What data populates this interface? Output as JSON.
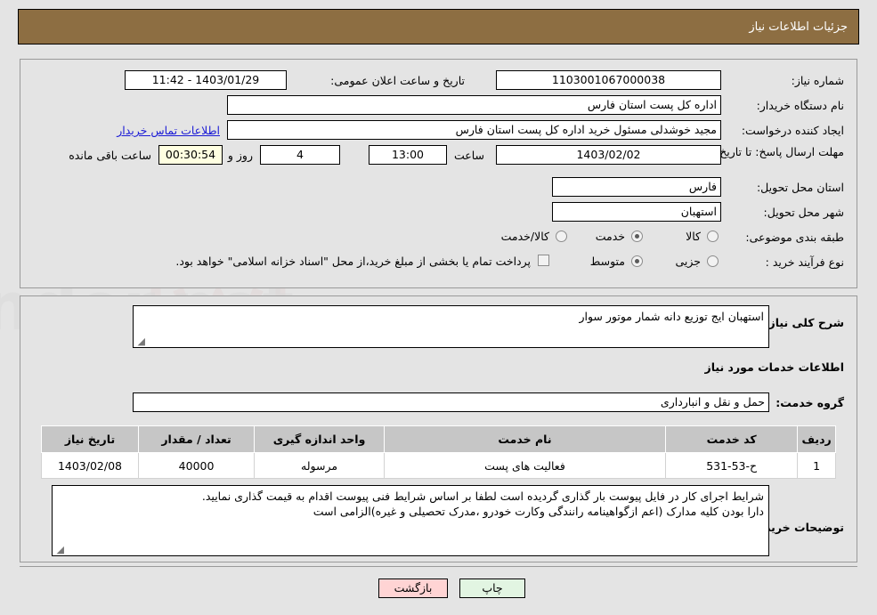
{
  "header": {
    "title": "جزئیات اطلاعات نیاز",
    "bar_color": "#8d6e42"
  },
  "form": {
    "need_number": {
      "label": "شماره نیاز:",
      "value": "1103001067000038"
    },
    "public_announce": {
      "label": "تاریخ و ساعت اعلان عمومی:",
      "value": "1403/01/29 - 11:42"
    },
    "buyer_org": {
      "label": "نام دستگاه خریدار:",
      "value": "اداره کل پست استان فارس"
    },
    "request_creator": {
      "label": "ایجاد کننده درخواست:",
      "value": "مجید خوشدلی مسئول خرید اداره کل پست استان فارس"
    },
    "contact_link": "اطلاعات تماس خریدار",
    "response_deadline": {
      "label": "مهلت ارسال پاسخ: تا تاریخ:",
      "date": "1403/02/02",
      "hour_label": "ساعت",
      "hour": "13:00",
      "days": "4",
      "days_label": "روز و",
      "countdown": "00:30:54",
      "remaining_label": "ساعت باقی مانده"
    },
    "delivery_province": {
      "label": "استان محل تحویل:",
      "value": "فارس"
    },
    "delivery_city": {
      "label": "شهر محل تحویل:",
      "value": "استهبان"
    },
    "subject_category": {
      "label": "طبقه بندی موضوعی:",
      "options": [
        "کالا",
        "خدمت",
        "کالا/خدمت"
      ],
      "selected": "خدمت"
    },
    "purchase_process": {
      "label": "نوع فرآیند خرید :",
      "options": [
        "جزیی",
        "متوسط"
      ],
      "selected": "متوسط"
    },
    "treasury_checkbox": {
      "checked": false,
      "label": "پرداخت تمام یا بخشی از مبلغ خرید،از محل \"اسناد خزانه اسلامی\" خواهد بود."
    }
  },
  "need_description": {
    "label": "شرح کلی نیاز:",
    "value": "استهبان ایج توزیع دانه شمار موتور سوار"
  },
  "services_section": {
    "heading": "اطلاعات خدمات مورد نیاز",
    "service_group": {
      "label": "گروه خدمت:",
      "value": "حمل و نقل و انبارداری"
    }
  },
  "services_table": {
    "columns": [
      "ردیف",
      "کد خدمت",
      "نام خدمت",
      "واحد اندازه گیری",
      "تعداد / مقدار",
      "تاریخ نیاز"
    ],
    "rows": [
      {
        "row_no": "1",
        "service_code": "ح-53-531",
        "service_name": "فعالیت های پست",
        "unit": "مرسوله",
        "quantity": "40000",
        "need_date": "1403/02/08"
      }
    ]
  },
  "buyer_notes": {
    "label": "توضیحات خریدار:",
    "line1": "شرایط اجرای کار در فایل پیوست بار گذاری گردیده است لطفا بر اساس شرایط فنی پیوست اقدام به قیمت گذاری نمایید.",
    "line2": "دارا بودن کلیه مدارک (اعم ازگواهینامه رانندگی وکارت خودرو ،مدرک تحصیلی و غیره)الزامی است"
  },
  "footer": {
    "back_button": "بازگشت",
    "print_button": "چاپ"
  }
}
